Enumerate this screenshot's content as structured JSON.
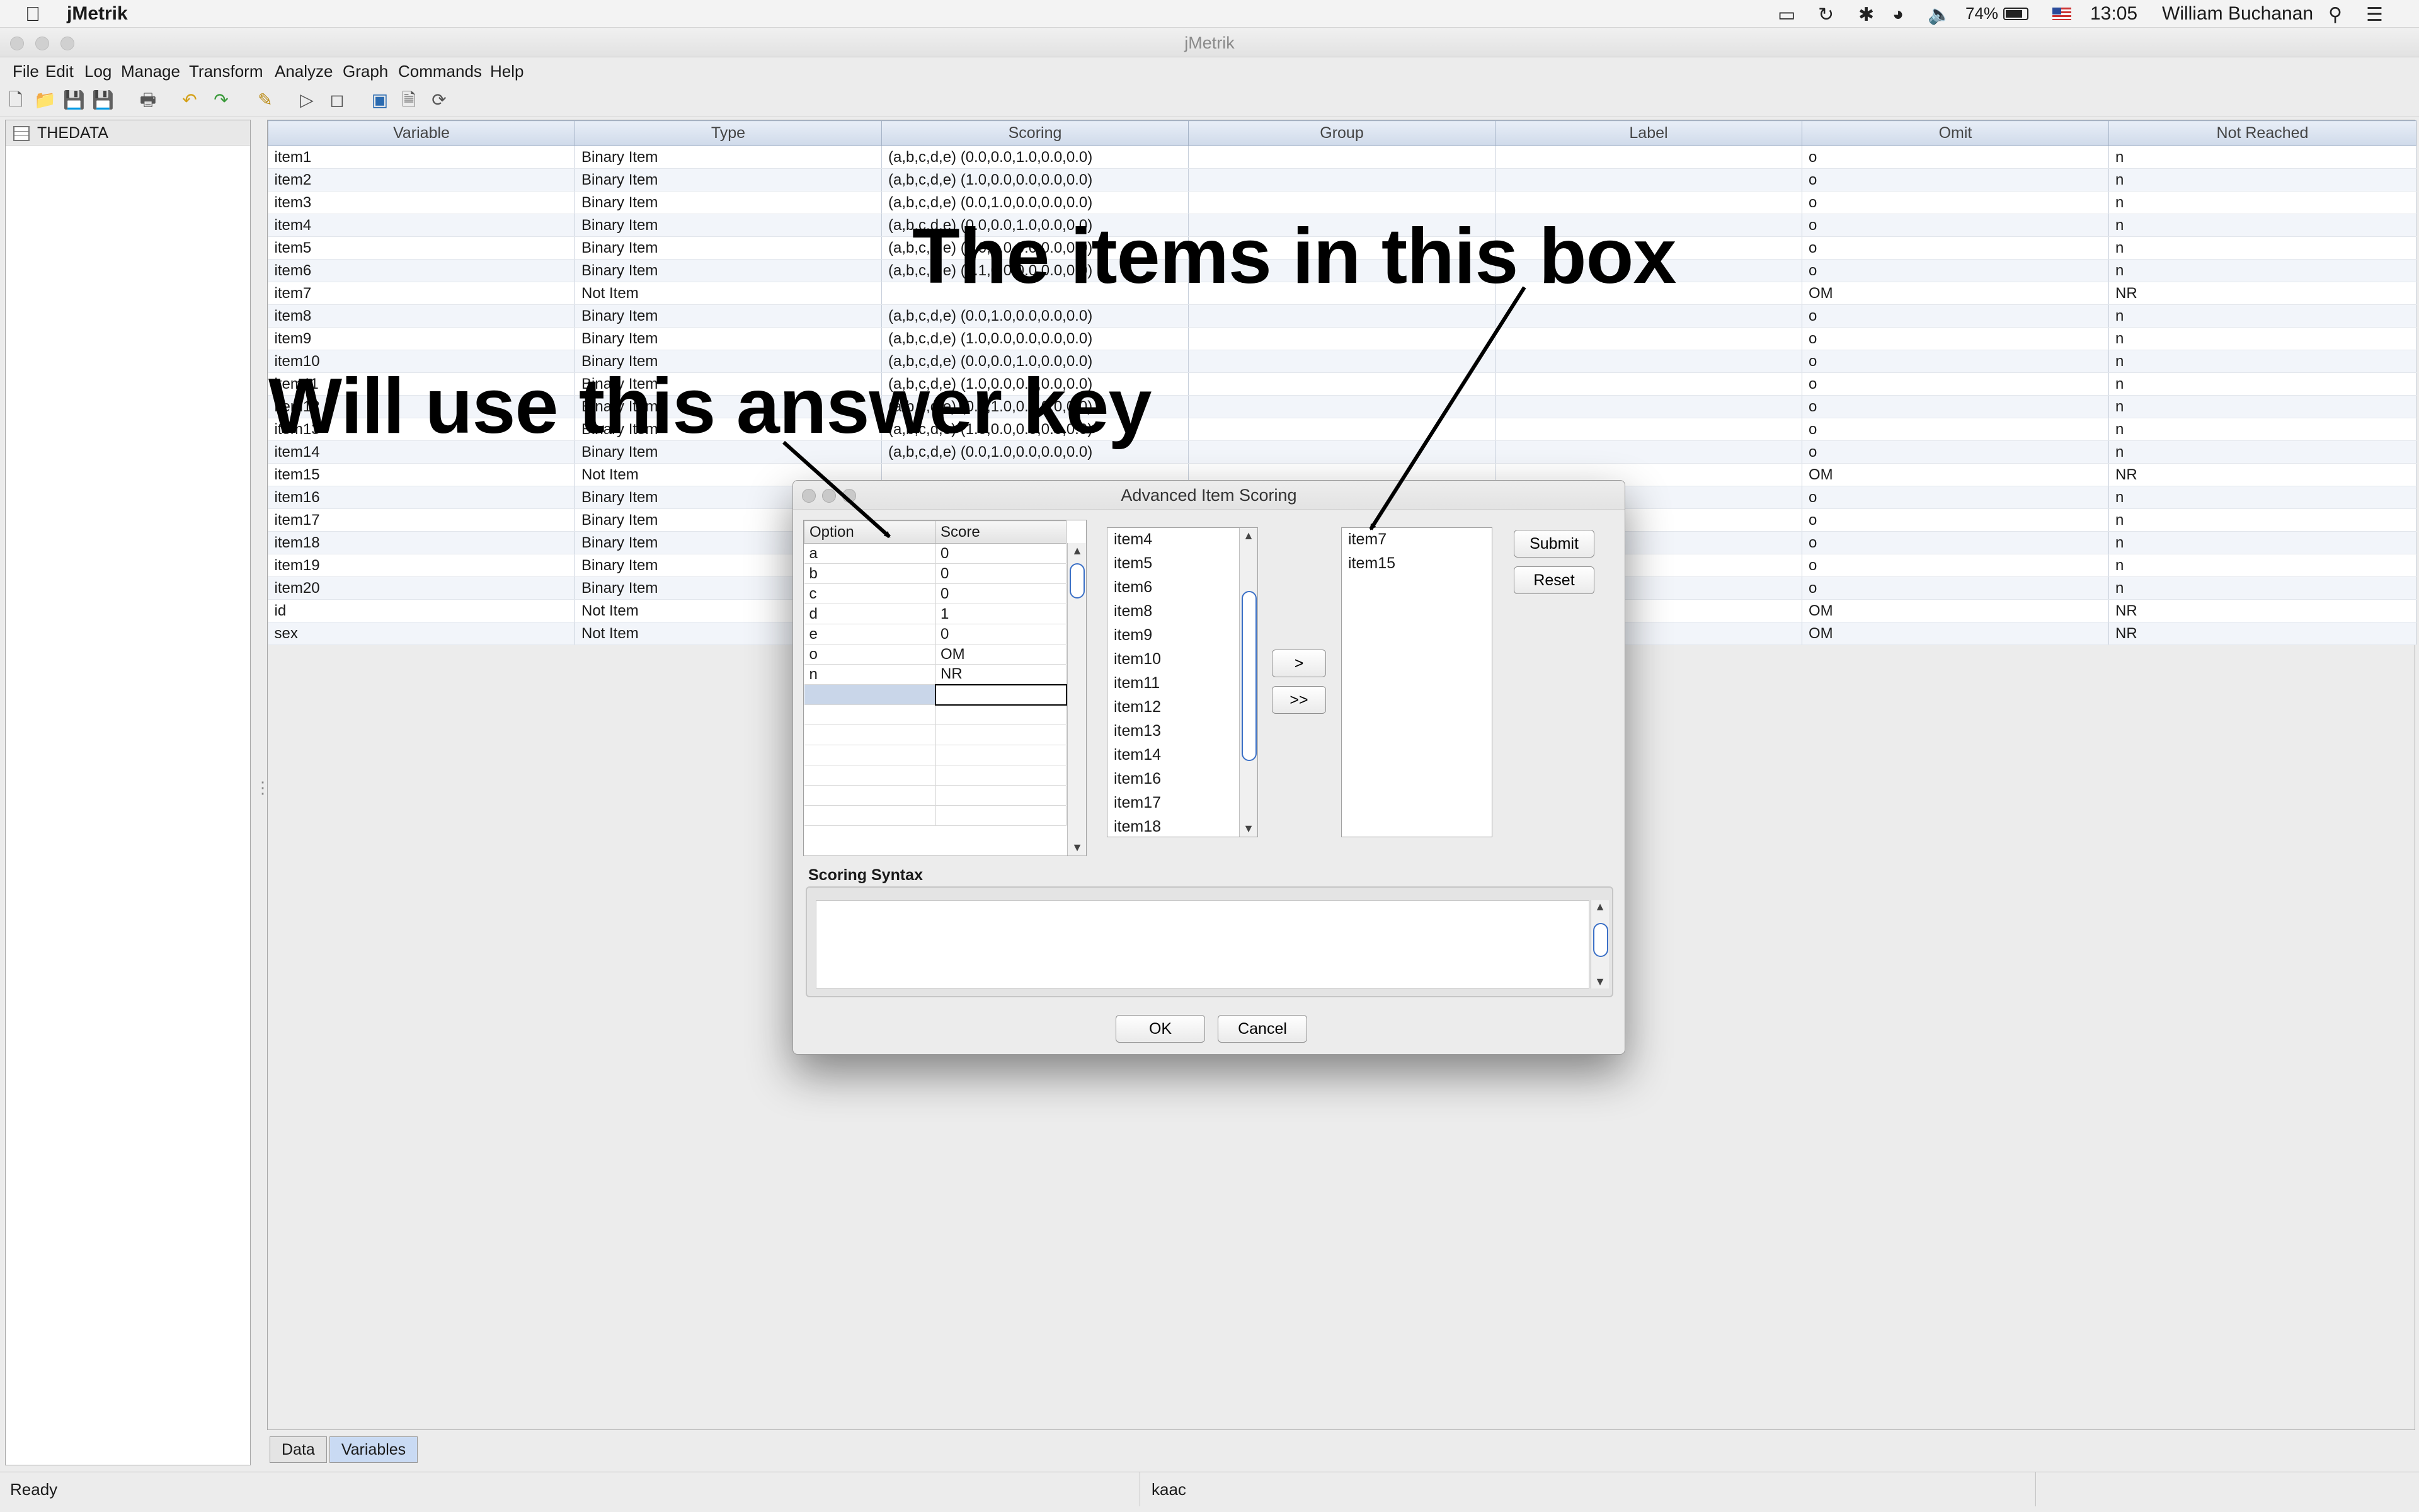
{
  "mac_menubar": {
    "app_name": "jMetrik",
    "battery": "74%",
    "clock": "13:05",
    "user": "William Buchanan",
    "icons": [
      "apple-logo",
      "airplay-icon",
      "time-machine-icon",
      "bluetooth-icon",
      "wifi-icon",
      "volume-icon",
      "battery-icon",
      "flag-icon",
      "search-icon",
      "control-center-icon"
    ]
  },
  "window": {
    "title": "jMetrik"
  },
  "menu": [
    "File",
    "Edit",
    "Log",
    "Manage",
    "Transform",
    "Analyze",
    "Graph",
    "Commands",
    "Help"
  ],
  "toolbar_icons": [
    "new-file-icon",
    "open-folder-icon",
    "save-icon",
    "save-all-icon",
    "print-icon",
    "undo-icon",
    "redo-icon",
    "edit-icon",
    "run-icon",
    "stop-icon",
    "image-icon",
    "page-icon",
    "refresh-icon"
  ],
  "tree": {
    "root": "THEDATA"
  },
  "var_table": {
    "columns": [
      "Variable",
      "Type",
      "Scoring",
      "Group",
      "Label",
      "Omit",
      "Not Reached"
    ],
    "rows": [
      [
        "item1",
        "Binary Item",
        "(a,b,c,d,e) (0.0,0.0,1.0,0.0,0.0)",
        "",
        "",
        "o",
        "n"
      ],
      [
        "item2",
        "Binary Item",
        "(a,b,c,d,e) (1.0,0.0,0.0,0.0,0.0)",
        "",
        "",
        "o",
        "n"
      ],
      [
        "item3",
        "Binary Item",
        "(a,b,c,d,e) (0.0,1.0,0.0,0.0,0.0)",
        "",
        "",
        "o",
        "n"
      ],
      [
        "item4",
        "Binary Item",
        "(a,b,c,d,e) (0.0,0.0,1.0,0.0,0.0)",
        "",
        "",
        "o",
        "n"
      ],
      [
        "item5",
        "Binary Item",
        "(a,b,c,d,e) (0.0,1.0,0.0,0.0,0.0)",
        "",
        "",
        "o",
        "n"
      ],
      [
        "item6",
        "Binary Item",
        "(a,b,c,d,e) (0.1,0.0,0.0,0.0,0.0)",
        "",
        "",
        "o",
        "n"
      ],
      [
        "item7",
        "Not Item",
        "",
        "",
        "",
        "OM",
        "NR"
      ],
      [
        "item8",
        "Binary Item",
        "(a,b,c,d,e) (0.0,1.0,0.0,0.0,0.0)",
        "",
        "",
        "o",
        "n"
      ],
      [
        "item9",
        "Binary Item",
        "(a,b,c,d,e) (1.0,0.0,0.0,0.0,0.0)",
        "",
        "",
        "o",
        "n"
      ],
      [
        "item10",
        "Binary Item",
        "(a,b,c,d,e) (0.0,0.0,1.0,0.0,0.0)",
        "",
        "",
        "o",
        "n"
      ],
      [
        "item11",
        "Binary Item",
        "(a,b,c,d,e) (1.0,0.0,0.0,0.0,0.0)",
        "",
        "",
        "o",
        "n"
      ],
      [
        "item12",
        "Binary Item",
        "(a,b,c,d,e) (0.0,1.0,0.0,0.0,0.0)",
        "",
        "",
        "o",
        "n"
      ],
      [
        "item13",
        "Binary Item",
        "(a,b,c,d,e) (1.0,0.0,0.0,0.0,0.0)",
        "",
        "",
        "o",
        "n"
      ],
      [
        "item14",
        "Binary Item",
        "(a,b,c,d,e) (0.0,1.0,0.0,0.0,0.0)",
        "",
        "",
        "o",
        "n"
      ],
      [
        "item15",
        "Not Item",
        "",
        "",
        "",
        "OM",
        "NR"
      ],
      [
        "item16",
        "Binary Item",
        "",
        "",
        "",
        "o",
        "n"
      ],
      [
        "item17",
        "Binary Item",
        "",
        "",
        "",
        "o",
        "n"
      ],
      [
        "item18",
        "Binary Item",
        "",
        "",
        "",
        "o",
        "n"
      ],
      [
        "item19",
        "Binary Item",
        "",
        "",
        "",
        "o",
        "n"
      ],
      [
        "item20",
        "Binary Item",
        "",
        "",
        "",
        "o",
        "n"
      ],
      [
        "id",
        "Not Item",
        "",
        "",
        "",
        "OM",
        "NR"
      ],
      [
        "sex",
        "Not Item",
        "",
        "",
        "",
        "OM",
        "NR"
      ]
    ]
  },
  "bottom_tabs": [
    "Data",
    "Variables"
  ],
  "status": {
    "left": "Ready",
    "middle": "kaac",
    "right": ""
  },
  "dialog": {
    "title": "Advanced Item Scoring",
    "option_table": {
      "columns": [
        "Option",
        "Score"
      ],
      "rows": [
        [
          "a",
          "0"
        ],
        [
          "b",
          "0"
        ],
        [
          "c",
          "0"
        ],
        [
          "d",
          "1"
        ],
        [
          "e",
          "0"
        ],
        [
          "o",
          "OM"
        ],
        [
          "n",
          "NR"
        ]
      ],
      "blank_rows": 7
    },
    "available_items": [
      "item4",
      "item5",
      "item6",
      "item8",
      "item9",
      "item10",
      "item11",
      "item12",
      "item13",
      "item14",
      "item16",
      "item17",
      "item18"
    ],
    "selected_items": [
      "item7",
      "item15"
    ],
    "buttons": {
      "move_one": ">",
      "move_all": ">>",
      "submit": "Submit",
      "reset": "Reset",
      "ok": "OK",
      "cancel": "Cancel"
    },
    "syntax_label": "Scoring Syntax",
    "syntax_value": ""
  },
  "annotations": {
    "box_note": "The items in this box",
    "key_note": "Will use this answer key"
  }
}
